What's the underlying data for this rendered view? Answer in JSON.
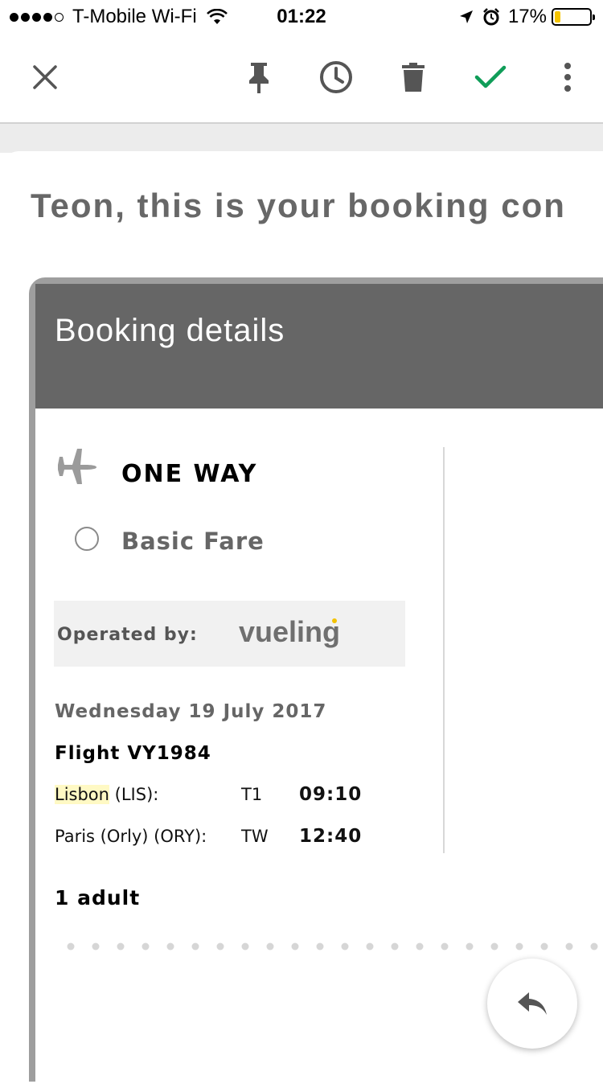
{
  "status_bar": {
    "carrier": "T-Mobile Wi-Fi",
    "time": "01:22",
    "battery": "17%",
    "battery_level": 0.17,
    "battery_color": "#f5c400"
  },
  "toolbar": {
    "icons": [
      "close-icon",
      "pin-icon",
      "snooze-icon",
      "delete-icon",
      "done-icon",
      "more-vert-icon"
    ],
    "done_color": "#0f9d58"
  },
  "email": {
    "heading": "Teon, this is your booking con"
  },
  "booking": {
    "header_title": "Booking details",
    "trip_type": "ONE WAY",
    "fare": "Basic Fare",
    "operated_by_label": "Operated by:",
    "airline_logo": "vueling",
    "date": "Wednesday 19 July 2017",
    "flight": "Flight VY1984",
    "legs": [
      {
        "city": "Lisbon",
        "code": "(LIS):",
        "terminal": "T1",
        "time": "09:10"
      },
      {
        "city": "Paris (Orly)",
        "code": "(ORY):",
        "terminal": "TW",
        "time": "12:40"
      }
    ],
    "passengers": "1 adult"
  },
  "fab": {
    "icon": "reply-icon"
  }
}
